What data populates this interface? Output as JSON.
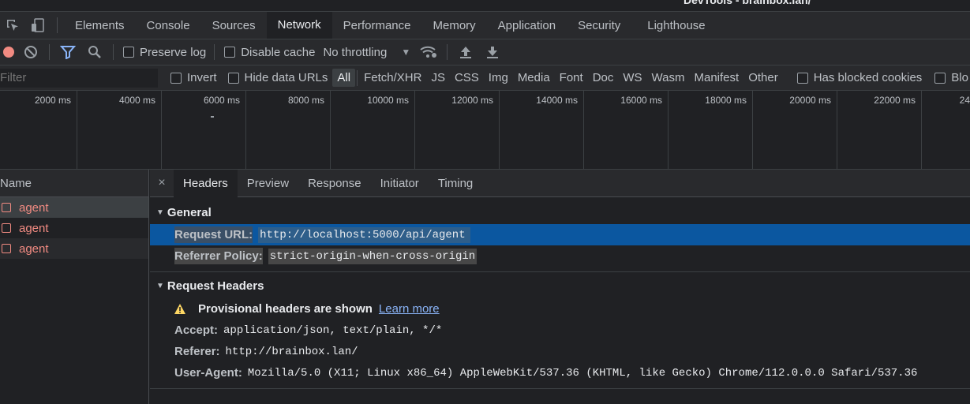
{
  "window": {
    "title": "DevTools - brainbox.lan/"
  },
  "panel_tabs": [
    "Elements",
    "Console",
    "Sources",
    "Network",
    "Performance",
    "Memory",
    "Application",
    "Security",
    "Lighthouse"
  ],
  "active_panel": "Network",
  "toolbar": {
    "preserve_log": "Preserve log",
    "disable_cache": "Disable cache",
    "throttling": "No throttling"
  },
  "filter": {
    "placeholder": "Filter",
    "invert": "Invert",
    "hide_data_urls": "Hide data URLs",
    "types": [
      "All",
      "Fetch/XHR",
      "JS",
      "CSS",
      "Img",
      "Media",
      "Font",
      "Doc",
      "WS",
      "Wasm",
      "Manifest",
      "Other"
    ],
    "active_type": "All",
    "has_blocked_cookies": "Has blocked cookies",
    "blocked_requests": "Blo"
  },
  "timeline": {
    "ticks": [
      "2000 ms",
      "4000 ms",
      "6000 ms",
      "8000 ms",
      "10000 ms",
      "12000 ms",
      "14000 ms",
      "16000 ms",
      "18000 ms",
      "20000 ms",
      "22000 ms",
      "24"
    ]
  },
  "requests": {
    "header": "Name",
    "rows": [
      "agent",
      "agent",
      "agent"
    ]
  },
  "details": {
    "close": "×",
    "tabs": [
      "Headers",
      "Preview",
      "Response",
      "Initiator",
      "Timing"
    ],
    "active_tab": "Headers",
    "general": {
      "title": "General",
      "request_url_key": "Request URL:",
      "request_url_value": "http://localhost:5000/api/agent",
      "referrer_policy_key": "Referrer Policy:",
      "referrer_policy_value": "strict-origin-when-cross-origin"
    },
    "request_headers": {
      "title": "Request Headers",
      "provisional": "Provisional headers are shown",
      "learn_more": "Learn more",
      "accept_key": "Accept:",
      "accept_value": "application/json, text/plain, */*",
      "referer_key": "Referer:",
      "referer_value": "http://brainbox.lan/",
      "user_agent_key": "User-Agent:",
      "user_agent_value": "Mozilla/5.0 (X11; Linux x86_64) AppleWebKit/537.36 (KHTML, like Gecko) Chrome/112.0.0.0 Safari/537.36"
    }
  },
  "colors": {
    "accent": "#8ab4f8",
    "error": "#f28b82",
    "selected": "#0b57a0"
  }
}
